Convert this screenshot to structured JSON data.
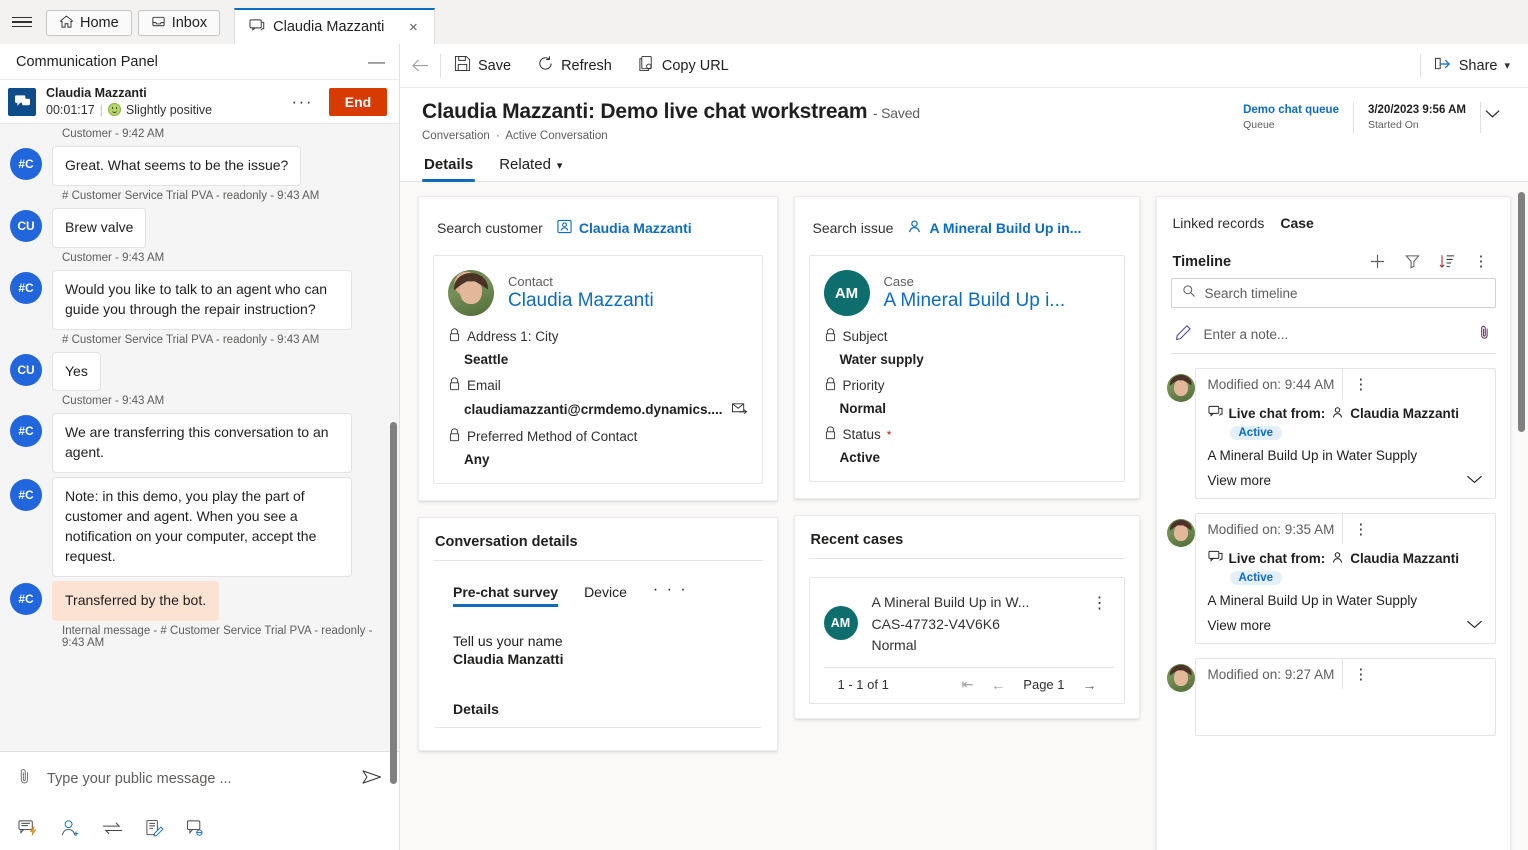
{
  "tabstrip": {
    "menu_icon": "hamburger-icon",
    "home_label": "Home",
    "inbox_label": "Inbox",
    "active_tab_label": "Claudia Mazzanti",
    "close_label": "×"
  },
  "comm_panel": {
    "header_title": "Communication Panel",
    "minimize_label": "—",
    "conversation": {
      "name": "Claudia Mazzanti",
      "timer": "00:01:17",
      "separator": "|",
      "sentiment": "Slightly positive",
      "more_label": "···",
      "end_label": "End"
    },
    "messages": [
      {
        "kind": "meta",
        "text": "Customer - 9:42 AM"
      },
      {
        "kind": "bubble",
        "initials": "#C",
        "text": "Great. What seems to be the issue?",
        "internal": false
      },
      {
        "kind": "meta",
        "text": "# Customer Service Trial PVA - readonly - 9:43 AM"
      },
      {
        "kind": "bubble",
        "initials": "CU",
        "text": "Brew valve",
        "internal": false
      },
      {
        "kind": "meta",
        "text": "Customer - 9:43 AM"
      },
      {
        "kind": "bubble",
        "initials": "#C",
        "text": "Would you like to talk to an agent who can guide you through the repair instruction?",
        "internal": false
      },
      {
        "kind": "meta",
        "text": "# Customer Service Trial PVA - readonly - 9:43 AM"
      },
      {
        "kind": "bubble",
        "initials": "CU",
        "text": "Yes",
        "internal": false
      },
      {
        "kind": "meta",
        "text": "Customer - 9:43 AM"
      },
      {
        "kind": "bubble",
        "initials": "#C",
        "text": "We are transferring this conversation to an agent.",
        "internal": false
      },
      {
        "kind": "bubble",
        "initials": "#C",
        "text": "Note: in this demo, you play the part of customer and agent. When you see a notification on your computer, accept the request.",
        "internal": false
      },
      {
        "kind": "bubble",
        "initials": "#C",
        "text": "Transferred by the bot.",
        "internal": true
      },
      {
        "kind": "meta",
        "text": "Internal message - # Customer Service Trial PVA - readonly - 9:43 AM"
      }
    ],
    "composer": {
      "placeholder": "Type your public message ...",
      "value": "",
      "attach_icon": "paperclip-icon",
      "send_icon": "send-icon",
      "tools": [
        "quick-reply-icon",
        "add-agent-icon",
        "transfer-icon",
        "notes-icon",
        "linked-conversation-icon"
      ]
    }
  },
  "command_bar": {
    "back_icon": "back-arrow-icon",
    "save_label": "Save",
    "refresh_label": "Refresh",
    "copy_url_label": "Copy URL",
    "share_label": "Share"
  },
  "record_header": {
    "title": "Claudia Mazzanti: Demo live chat workstream",
    "saved_suffix": "- Saved",
    "breadcrumb_entity": "Conversation",
    "breadcrumb_sep": "·",
    "breadcrumb_view": "Active Conversation",
    "queue_value": "Demo chat queue",
    "queue_label": "Queue",
    "started_value": "3/20/2023 9:56 AM",
    "started_label": "Started On"
  },
  "record_tabs": [
    {
      "label": "Details",
      "active": true,
      "chevron": false
    },
    {
      "label": "Related",
      "active": false,
      "chevron": true
    }
  ],
  "customer_card": {
    "search_label": "Search customer",
    "search_value": "Claudia Mazzanti",
    "entity_type": "Contact",
    "entity_name": "Claudia Mazzanti",
    "fields": [
      {
        "label": "Address 1: City",
        "value": "Seattle",
        "required": false,
        "has_email_icon": false
      },
      {
        "label": "Email",
        "value": "claudiamazzanti@crmdemo.dynamics....",
        "required": false,
        "has_email_icon": true
      },
      {
        "label": "Preferred Method of Contact",
        "value": "Any",
        "required": false,
        "has_email_icon": false
      }
    ]
  },
  "case_card": {
    "search_label": "Search issue",
    "search_value": "A Mineral Build Up in...",
    "entity_type": "Case",
    "entity_initials": "AM",
    "entity_name": "A Mineral Build Up i...",
    "fields": [
      {
        "label": "Subject",
        "value": "Water supply",
        "required": false
      },
      {
        "label": "Priority",
        "value": "Normal",
        "required": false
      },
      {
        "label": "Status",
        "value": "Active",
        "required": true
      }
    ]
  },
  "conversation_details": {
    "title": "Conversation details",
    "tabs": [
      {
        "label": "Pre-chat survey",
        "active": true
      },
      {
        "label": "Device",
        "active": false
      }
    ],
    "overflow_label": "· · ·",
    "question": "Tell us your name",
    "answer": "Claudia Manzatti",
    "details_heading": "Details"
  },
  "recent_cases": {
    "title": "Recent cases",
    "items": [
      {
        "initials": "AM",
        "title": "A Mineral Build Up in W...",
        "number": "CAS-47732-V4V6K6",
        "priority": "Normal"
      }
    ],
    "count_label": "1 - 1 of 1",
    "page_label": "Page 1",
    "first_icon": "first-page-icon",
    "prev_icon": "prev-page-icon",
    "next_icon": "next-page-icon"
  },
  "right_panel": {
    "linked_records_label": "Linked records",
    "linked_records_value": "Case",
    "timeline_title": "Timeline",
    "actions": [
      "add-icon",
      "filter-icon",
      "sort-icon",
      "more-icon"
    ],
    "search_placeholder": "Search timeline",
    "search_value": "",
    "note_placeholder": "Enter a note...",
    "note_attach_icon": "paperclip-icon",
    "items": [
      {
        "modified": "Modified on: 9:44 AM",
        "live_chat_prefix": "Live chat from:",
        "person": "Claudia Mazzanti",
        "badge": "Active",
        "subject": "A Mineral Build Up in Water Supply",
        "view_more": "View more",
        "expanded": true
      },
      {
        "modified": "Modified on: 9:35 AM",
        "live_chat_prefix": "Live chat from:",
        "person": "Claudia Mazzanti",
        "badge": "Active",
        "subject": "A Mineral Build Up in Water Supply",
        "view_more": "View more",
        "expanded": true
      },
      {
        "modified": "Modified on: 9:27 AM",
        "live_chat_prefix": "",
        "person": "",
        "badge": "",
        "subject": "",
        "view_more": "",
        "expanded": false
      }
    ]
  },
  "colors": {
    "accent": "#0f6cbd",
    "end_button": "#d83b01",
    "case_avatar": "#0e6e6e",
    "bot_avatar": "#2266dd",
    "internal_bubble": "#fbe2d2",
    "badge_bg": "#e3effb"
  }
}
